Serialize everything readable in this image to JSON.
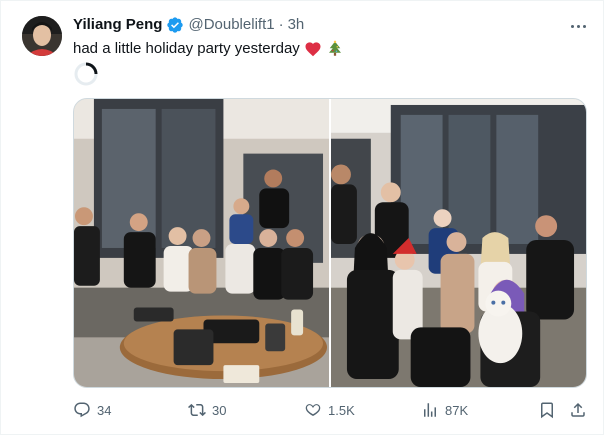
{
  "author": {
    "name": "Yiliang Peng",
    "handle": "@Doublelift1",
    "separator": "·",
    "time": "3h"
  },
  "tweet": {
    "text": "had a little holiday party yesterday",
    "emojis": [
      "red-heart",
      "christmas-tree"
    ]
  },
  "media": {
    "count": 2,
    "alt": [
      "Group photo of friends gathered around a sofa and coffee table",
      "Group photo of friends with a white cat"
    ]
  },
  "actions": {
    "replies": "34",
    "reposts": "30",
    "likes": "1.5K",
    "views": "87K"
  },
  "icons": [
    "verified-badge-icon",
    "more-icon",
    "reply-icon",
    "repost-icon",
    "like-icon",
    "views-icon",
    "bookmark-icon",
    "share-icon",
    "loading-spinner-icon"
  ],
  "colors": {
    "verified": "#1d9bf0",
    "secondary_text": "#536471",
    "primary_text": "#0f1419",
    "heart": "#e0245e"
  }
}
